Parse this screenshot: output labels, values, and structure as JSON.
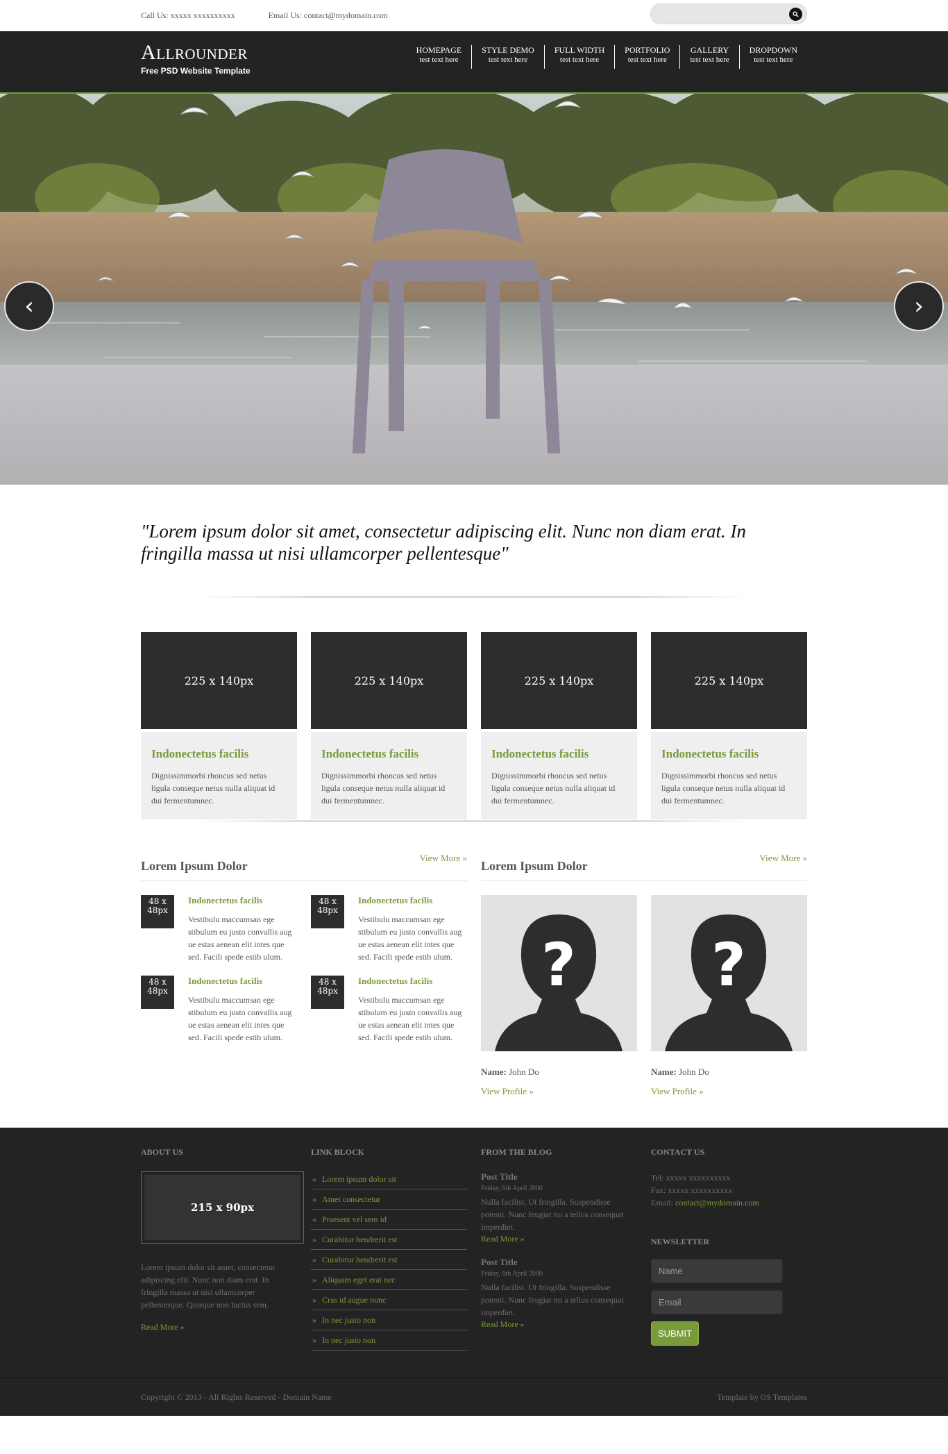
{
  "topbar": {
    "call": "Call Us: xxxxx xxxxxxxxxx",
    "email": "Email Us: contact@mydomain.com",
    "search_icon": "search-icon"
  },
  "header": {
    "logo_name": "Allrounder",
    "logo_tagline": "Free PSD Website Template",
    "nav": [
      {
        "title": "HOMEPAGE",
        "sub": "test text here"
      },
      {
        "title": "STYLE DEMO",
        "sub": "test text here"
      },
      {
        "title": "FULL WIDTH",
        "sub": "test text here"
      },
      {
        "title": "PORTFOLIO",
        "sub": "test text here"
      },
      {
        "title": "GALLERY",
        "sub": "test text here"
      },
      {
        "title": "DROPDOWN",
        "sub": "test text here"
      }
    ],
    "accent": "#7a9b3a"
  },
  "slider": {
    "prev": "‹",
    "next": "›"
  },
  "quote": "\"Lorem ipsum dolor sit amet, consectetur adipiscing elit. Nunc non diam erat. In fringilla massa ut nisi ullamcorper pellentesque\"",
  "features": [
    {
      "thumb": "225 x 140px",
      "title": "Indonectetus facilis",
      "text": "Dignissimmorbi rhoncus sed netus ligula conseque netus nulla aliquat id dui fermentumnec."
    },
    {
      "thumb": "225 x 140px",
      "title": "Indonectetus facilis",
      "text": "Dignissimmorbi rhoncus sed netus ligula conseque netus nulla aliquat id dui fermentumnec."
    },
    {
      "thumb": "225 x 140px",
      "title": "Indonectetus facilis",
      "text": "Dignissimmorbi rhoncus sed netus ligula conseque netus nulla aliquat id dui fermentumnec."
    },
    {
      "thumb": "225 x 140px",
      "title": "Indonectetus facilis",
      "text": "Dignissimmorbi rhoncus sed netus ligula conseque netus nulla aliquat id dui fermentumnec."
    }
  ],
  "posts_section": {
    "title": "Lorem Ipsum Dolor",
    "view_more": "View More »",
    "posts": [
      {
        "thumb": "48 x 48px",
        "title": "Indonectetus facilis",
        "text": "Vestibulu maccumsan ege stibulum eu justo convallis aug ue estas aenean elit intes que sed. Facili spede estib ulum."
      },
      {
        "thumb": "48 x 48px",
        "title": "Indonectetus facilis",
        "text": "Vestibulu maccumsan ege stibulum eu justo convallis aug ue estas aenean elit intes que sed. Facili spede estib ulum."
      },
      {
        "thumb": "48 x 48px",
        "title": "Indonectetus facilis",
        "text": "Vestibulu maccumsan ege stibulum eu justo convallis aug ue estas aenean elit intes que sed. Facili spede estib ulum."
      },
      {
        "thumb": "48 x 48px",
        "title": "Indonectetus facilis",
        "text": "Vestibulu maccumsan ege stibulum eu justo convallis aug ue estas aenean elit intes que sed. Facili spede estib ulum."
      }
    ]
  },
  "team_section": {
    "title": "Lorem Ipsum Dolor",
    "view_more": "View More »",
    "people": [
      {
        "name_label": "Name:",
        "name": "John Do",
        "link": "View Profile »"
      },
      {
        "name_label": "Name:",
        "name": "John Do",
        "link": "View Profile »"
      }
    ]
  },
  "footer": {
    "about": {
      "heading": "ABOUT US",
      "image": "215 x 90px",
      "text": "Lorem ipsum dolor sit amet, consectetur adipiscing elit. Nunc non diam erat. In fringilla massa ut nisi ullamcorper pellentesque. Quisque non luctus sem.",
      "read_more": "Read More »"
    },
    "links": {
      "heading": "LINK BLOCK",
      "items": [
        "Lorem ipsum dolor sit",
        "Amet consectetur",
        "Praesent vel sem id",
        "Curabitur hendrerit est",
        "Curabitur hendrerit est",
        "Aliquam eget erat nec",
        "Cras id augue nunc",
        "In nec justo non",
        "In nec justo non"
      ]
    },
    "blog": {
      "heading": "FROM THE BLOG",
      "posts": [
        {
          "title": "Post Title",
          "date": "Friday, 6th April 2000",
          "text": "Nulla facilisi. Ut fringilla. Suspendisse potenti. Nunc feugiat mi a tellus consequat imperdiet.",
          "read_more": "Read More »"
        },
        {
          "title": "Post Title",
          "date": "Friday, 6th April 2000",
          "text": "Nulla facilisi. Ut fringilla. Suspendisse potenti. Nunc feugiat mi a tellus consequat imperdiet.",
          "read_more": "Read More »"
        }
      ]
    },
    "contact": {
      "heading": "CONTACT US",
      "tel": "Tel: xxxxx xxxxxxxxxx",
      "fax": "Fax: xxxxx xxxxxxxxxx",
      "email_label": "Email:",
      "email": "contact@mydomain.com"
    },
    "newsletter": {
      "heading": "NEWSLETTER",
      "name_placeholder": "Name",
      "email_placeholder": "Email",
      "submit": "SUBMIT"
    }
  },
  "copyright": {
    "left": "Copyright © 2013 - All Rights Reserved - Domain Name",
    "right": "Template by OS Templates"
  }
}
